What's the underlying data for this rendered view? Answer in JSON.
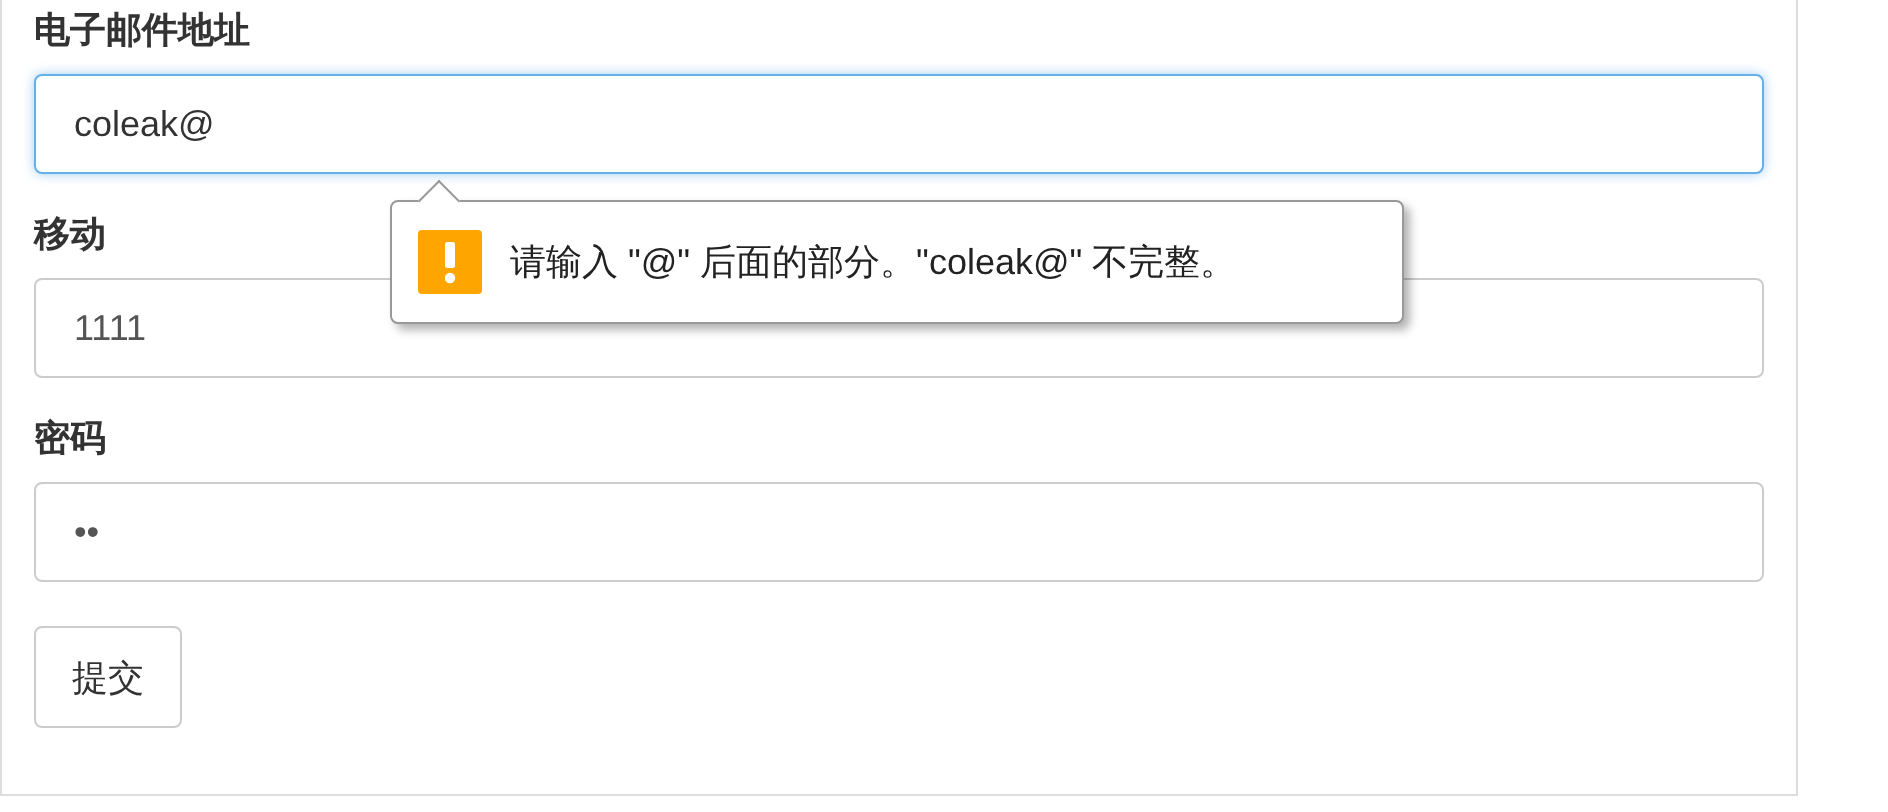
{
  "fields": [
    {
      "label": "电子邮件地址",
      "value": "coleak@",
      "focused": true
    },
    {
      "label": "移动",
      "value": "1111",
      "focused": false
    },
    {
      "label": "密码",
      "value": "••",
      "focused": false
    }
  ],
  "tooltip": {
    "message": "请输入 \"@\" 后面的部分。\"coleak@\" 不完整。"
  },
  "submit_button": "提交"
}
